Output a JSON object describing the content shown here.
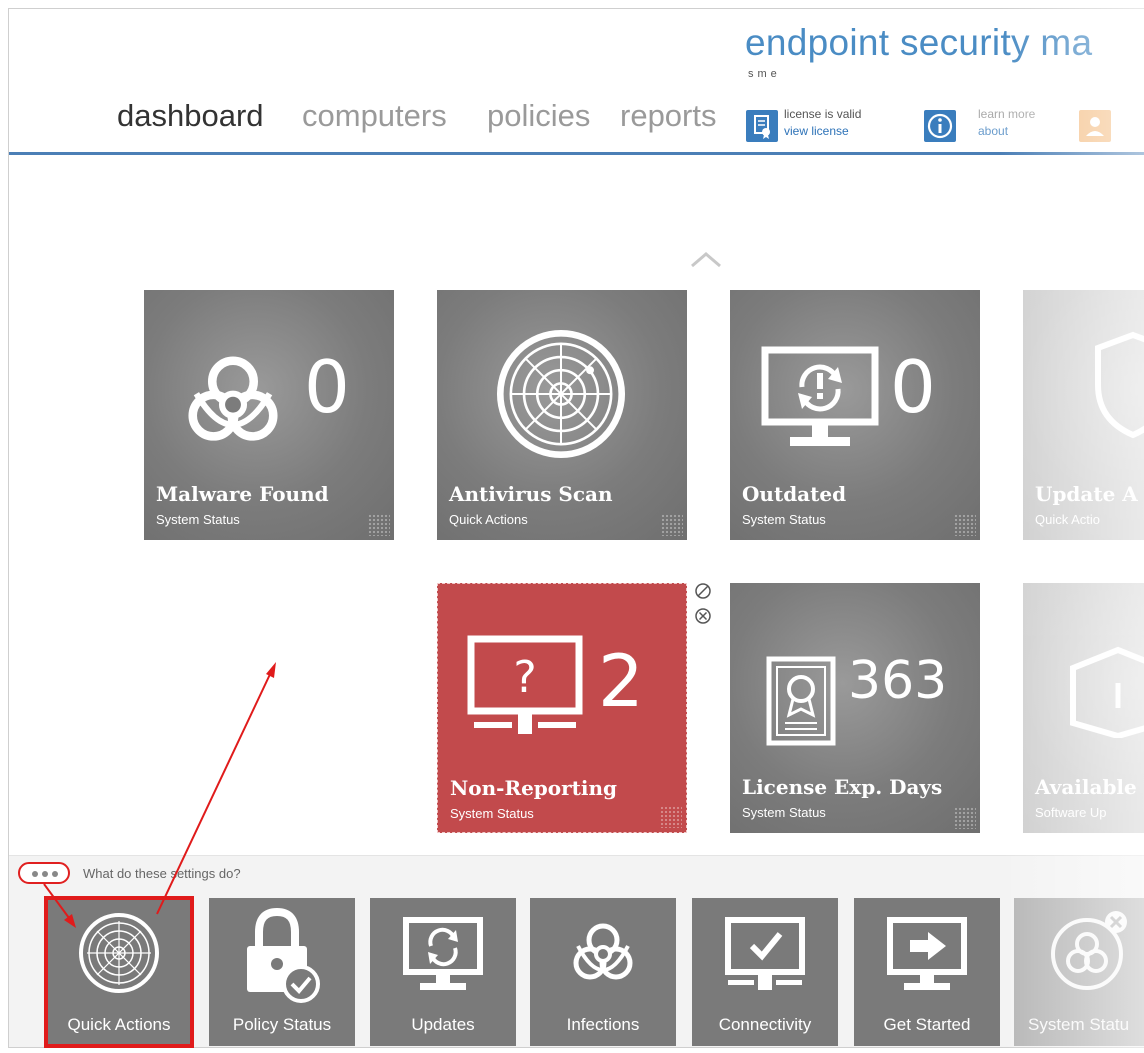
{
  "header": {
    "brand": "endpoint security ma",
    "brand_sub": "sme",
    "nav": [
      "dashboard",
      "computers",
      "policies",
      "reports"
    ],
    "license_status": "license is valid",
    "license_link": "view license",
    "learn_more": "learn more",
    "about_link": "about"
  },
  "tiles": [
    {
      "title": "Malware Found",
      "subtitle": "System Status",
      "count": "0"
    },
    {
      "title": "Antivirus Scan",
      "subtitle": "Quick Actions"
    },
    {
      "title": "Outdated",
      "subtitle": "System Status",
      "count": "0"
    },
    {
      "title": "Update A",
      "subtitle": "Quick Actio"
    },
    {
      "title": "Non-Reporting",
      "subtitle": "System Status",
      "count": "2"
    },
    {
      "title": "License Exp. Days",
      "subtitle": "System Status",
      "count": "363"
    },
    {
      "title": "Available",
      "subtitle": "Software Up"
    }
  ],
  "bottom": {
    "help_text": "What do these settings do?",
    "categories": [
      "Quick Actions",
      "Policy Status",
      "Updates",
      "Infections",
      "Connectivity",
      "Get Started",
      "System Statu"
    ]
  },
  "colors": {
    "accent": "#4b7fb6",
    "brand": "#4a8cc4",
    "tile": "#7c7c7c",
    "alert_tile": "#c24a4c",
    "annotation": "#e01b1b"
  }
}
